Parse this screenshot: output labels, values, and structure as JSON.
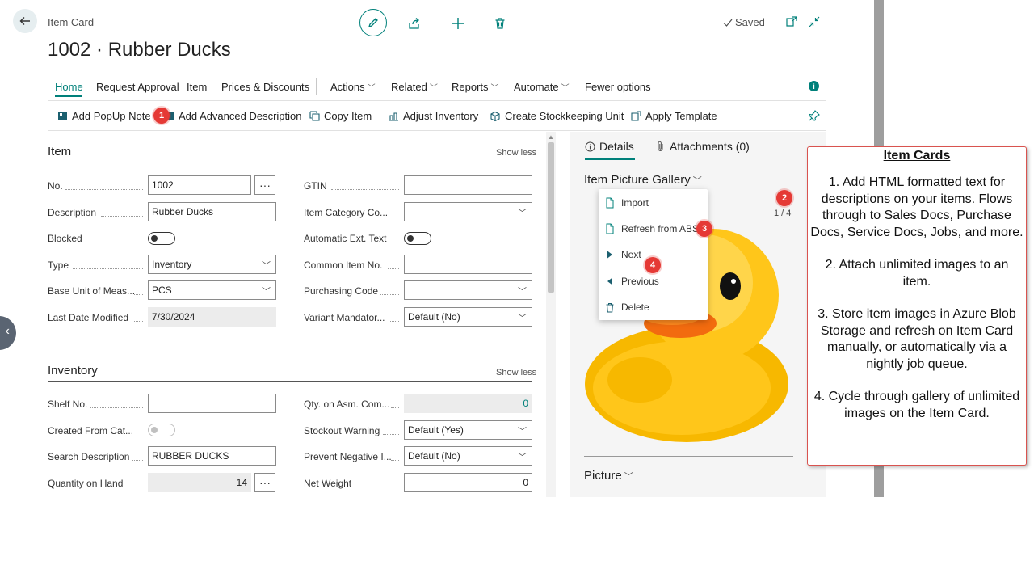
{
  "header": {
    "breadcrumb": "Item Card",
    "title": "1002 · Rubber Ducks",
    "saved_label": "Saved"
  },
  "nav": {
    "items": [
      "Home",
      "Request Approval",
      "Item",
      "Prices & Discounts",
      "Actions",
      "Related",
      "Reports",
      "Automate",
      "Fewer options"
    ]
  },
  "actions": {
    "items": [
      "Add PopUp Note",
      "Add Advanced Description",
      "Copy Item",
      "Adjust Inventory",
      "Create Stockkeeping Unit",
      "Apply Template"
    ]
  },
  "badges": [
    "1",
    "2",
    "3",
    "4"
  ],
  "item_section": {
    "title": "Item",
    "show_less": "Show less",
    "fields": {
      "no_label": "No.",
      "no_value": "1002",
      "description_label": "Description",
      "description_value": "Rubber Ducks",
      "blocked_label": "Blocked",
      "type_label": "Type",
      "type_value": "Inventory",
      "base_unit_label": "Base Unit of Meas...",
      "base_unit_value": "PCS",
      "last_modified_label": "Last Date Modified",
      "last_modified_value": "7/30/2024",
      "gtin_label": "GTIN",
      "gtin_value": "",
      "category_label": "Item Category Co...",
      "category_value": "",
      "auto_ext_label": "Automatic Ext. Text",
      "common_no_label": "Common Item No.",
      "common_no_value": "",
      "purchasing_label": "Purchasing Code",
      "purchasing_value": "",
      "variant_label": "Variant Mandator...",
      "variant_value": "Default (No)"
    }
  },
  "inventory_section": {
    "title": "Inventory",
    "show_less": "Show less",
    "fields": {
      "shelf_label": "Shelf No.",
      "shelf_value": "",
      "created_from_label": "Created From Cat...",
      "search_desc_label": "Search Description",
      "search_desc_value": "RUBBER DUCKS",
      "qoh_label": "Quantity on Hand",
      "qoh_value": "14",
      "qty_asm_label": "Qty. on Asm. Com...",
      "qty_asm_value": "0",
      "stockout_label": "Stockout Warning",
      "stockout_value": "Default (Yes)",
      "prevent_neg_label": "Prevent Negative I...",
      "prevent_neg_value": "Default (No)",
      "net_weight_label": "Net Weight",
      "net_weight_value": "0"
    }
  },
  "factbox": {
    "details_tab": "Details",
    "attachments_tab": "Attachments (0)",
    "gallery_title": "Item Picture Gallery",
    "counter": "1 / 4",
    "menu": [
      "Import",
      "Refresh from ABS",
      "Next",
      "Previous",
      "Delete"
    ],
    "picture_title": "Picture"
  },
  "callout": {
    "title": "Item Cards",
    "points": [
      "1. Add HTML formatted text for descriptions on your items. Flows through to Sales Docs, Purchase Docs, Service Docs, Jobs, and more.",
      "2. Attach unlimited images to an item.",
      "3. Store item images in Azure Blob Storage and refresh on Item Card manually, or automatically via a nightly job queue.",
      "4. Cycle through gallery of unlimited images on the Item Card."
    ]
  },
  "colors": {
    "accent": "#00807a",
    "badge": "#e53935",
    "callout_border": "#d9534f"
  }
}
